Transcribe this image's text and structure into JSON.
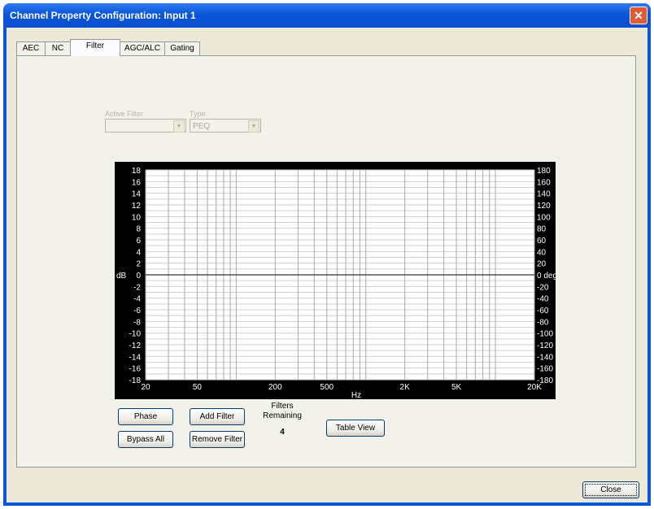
{
  "window": {
    "title": "Channel Property Configuration: Input 1",
    "close_glyph": "✕"
  },
  "tabs": [
    {
      "label": "AEC",
      "active": false
    },
    {
      "label": "NC",
      "active": false
    },
    {
      "label": "Filter",
      "active": true
    },
    {
      "label": "AGC/ALC",
      "active": false
    },
    {
      "label": "Gating",
      "active": false
    }
  ],
  "filter_panel": {
    "active_filter_label": "Active Filter",
    "active_filter_value": "",
    "type_label": "Type",
    "type_value": "PEQ",
    "dropdown_glyph": "▼"
  },
  "graph": {
    "left_axis_title": "dB",
    "right_axis_unit": "deg.",
    "x_axis_title": "Hz",
    "db_ticks": [
      "18",
      "16",
      "14",
      "12",
      "10",
      "8",
      "6",
      "4",
      "2",
      "0",
      "-2",
      "-4",
      "-6",
      "-8",
      "-10",
      "-12",
      "-14",
      "-16",
      "-18"
    ],
    "phase_ticks": [
      "180",
      "160",
      "140",
      "120",
      "100",
      "80",
      "60",
      "40",
      "20",
      "0 deg.",
      "-20",
      "-40",
      "-60",
      "-80",
      "-100",
      "-120",
      "-140",
      "-160",
      "-180"
    ],
    "freq_ticks": [
      "20",
      "50",
      "200",
      "500",
      "2K",
      "5K",
      "20K"
    ]
  },
  "buttons": {
    "phase": "Phase",
    "bypass_all": "Bypass All",
    "add_filter": "Add Filter",
    "remove_filter": "Remove Filter",
    "table_view": "Table View",
    "close": "Close"
  },
  "filters_remaining": {
    "label_line1": "Filters",
    "label_line2": "Remaining",
    "count": "4"
  },
  "chart_data": {
    "type": "line",
    "title": "",
    "xlabel": "Hz",
    "ylabel": "dB",
    "y2label": "deg.",
    "x_scale": "log",
    "xlim": [
      20,
      20000
    ],
    "ylim": [
      -18,
      18
    ],
    "y2lim": [
      -180,
      180
    ],
    "x_tick_labels": [
      "20",
      "50",
      "200",
      "500",
      "2K",
      "5K",
      "20K"
    ],
    "y_tick_step": 2,
    "y2_tick_step": 20,
    "grid": true,
    "series": [
      {
        "x": [
          20,
          20000
        ],
        "values": [
          0,
          0
        ]
      }
    ]
  }
}
